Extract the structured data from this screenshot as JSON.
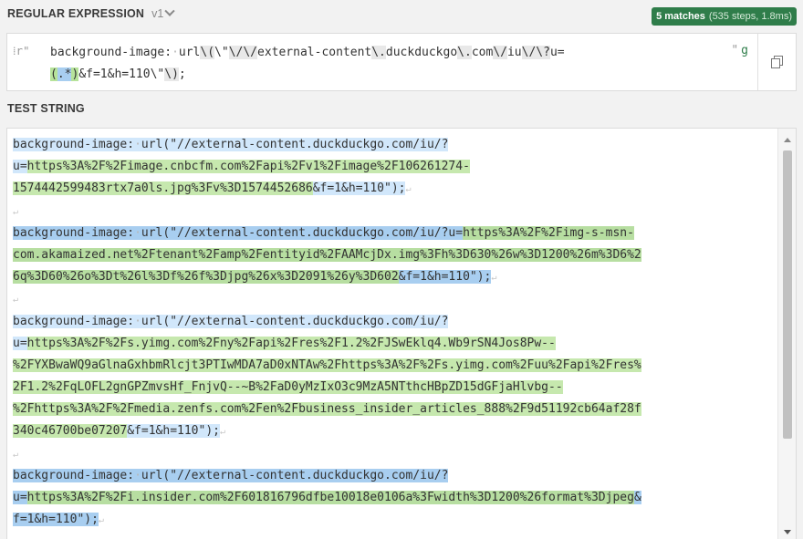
{
  "regex_section": {
    "title": "REGULAR EXPRESSION",
    "version": "v1",
    "matches_count": "5 matches",
    "matches_detail": "(535 steps, 1.8ms)",
    "delimiter_left": "r\"",
    "delimiter_right": "\"",
    "flags": "g",
    "pattern_line1": {
      "p1": "background-image:",
      "p2": "url",
      "p3": "\\(",
      "p4": "\\\"",
      "p5": "\\/",
      "p6": "\\/",
      "p7": "external-content",
      "p8": "\\.",
      "p9": "duckduckgo",
      "p10": "\\.",
      "p11": "com",
      "p12": "\\/",
      "p13": "iu",
      "p14": "\\/",
      "p15": "\\?",
      "p16": "u="
    },
    "pattern_line2": {
      "g_open": "(",
      "g_inner": ".*",
      "g_close": ")",
      "rest": "&f=1&h=110",
      "esc_q": "\\\"",
      "esc_p": "\\)",
      "end": ";"
    }
  },
  "test_section": {
    "title": "TEST STRING",
    "lines": [
      {
        "a": "background-image:",
        "b": "url(\"//external-content.duckduckgo.com/iu/?",
        "c": "",
        "d": "",
        "e": ""
      },
      {
        "a": "u=",
        "b": "",
        "c": "https%3A%2F%2Fimage.cnbcfm.com%2Fapi%2Fv1%2Fimage%2F106261274-",
        "d": "",
        "e": ""
      },
      {
        "a": "",
        "b": "",
        "c": "1574442599483rtx7a0ls.jpg%3Fv%3D1574452686",
        "d": "&f=1&h=110\");",
        "e": ""
      },
      {
        "a": "",
        "b": "",
        "c": "",
        "d": "",
        "e": ""
      },
      {
        "a": "background-image:",
        "b": "url(\"//external-content.duckduckgo.com/iu/?u=",
        "c": "https%3A%2F%2Fimg-s-msn-",
        "d": "",
        "e": ""
      },
      {
        "a": "",
        "b": "",
        "c": "com.akamaized.net%2Ftenant%2Famp%2Fentityid%2FAAMcjDx.img%3Fh%3D630%26w%3D1200%26m%3D6%2",
        "d": "",
        "e": ""
      },
      {
        "a": "",
        "b": "",
        "c": "6q%3D60%26o%3Dt%26l%3Df%26f%3Djpg%26x%3D2091%26y%3D602",
        "d": "&f=1&h=110\");",
        "e": ""
      },
      {
        "a": "",
        "b": "",
        "c": "",
        "d": "",
        "e": ""
      },
      {
        "a": "background-image:",
        "b": "url(\"//external-content.duckduckgo.com/iu/?",
        "c": "",
        "d": "",
        "e": ""
      },
      {
        "a": "u=",
        "b": "",
        "c": "https%3A%2F%2Fs.yimg.com%2Fny%2Fapi%2Fres%2F1.2%2FJSwEklq4.Wb9rSN4Jos8Pw--",
        "d": "",
        "e": ""
      },
      {
        "a": "",
        "b": "",
        "c": "%2FYXBwaWQ9aGlnaGxhbmRlcjt3PTIwMDA7aD0xNTAw%2Fhttps%3A%2F%2Fs.yimg.com%2Fuu%2Fapi%2Fres%",
        "d": "",
        "e": ""
      },
      {
        "a": "",
        "b": "",
        "c": "2F1.2%2FqLOFL2gnGPZmvsHf_FnjvQ--~B%2FaD0yMzIxO3c9MzA5NTthcHBpZD15dGFjaHlvbg--",
        "d": "",
        "e": ""
      },
      {
        "a": "",
        "b": "",
        "c": "%2Fhttps%3A%2F%2Fmedia.zenfs.com%2Fen%2Fbusiness_insider_articles_888%2F9d51192cb64af28f",
        "d": "",
        "e": ""
      },
      {
        "a": "",
        "b": "",
        "c": "340c46700be07207",
        "d": "&f=1&h=110\");",
        "e": ""
      },
      {
        "a": "",
        "b": "",
        "c": "",
        "d": "",
        "e": ""
      },
      {
        "a": "background-image:",
        "b": "url(\"//external-content.duckduckgo.com/iu/?",
        "c": "",
        "d": "",
        "e": ""
      },
      {
        "a": "u=",
        "b": "",
        "c": "https%3A%2F%2Fi.insider.com%2F601816796dfbe10018e0106a%3Fwidth%3D1200%26format%3Djpeg",
        "d": "&",
        "e": ""
      },
      {
        "a": "",
        "b": "",
        "c": "",
        "d": "f=1&h=110\");",
        "e": ""
      }
    ]
  }
}
